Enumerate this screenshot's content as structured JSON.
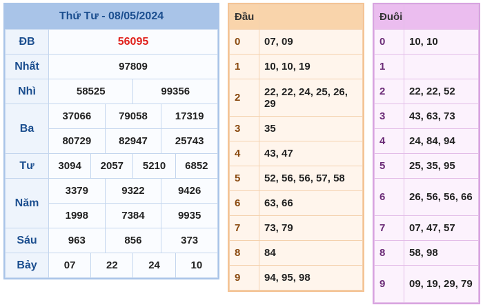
{
  "results": {
    "title": "Thứ Tư - 08/05/2024",
    "db": {
      "label": "ĐB",
      "value": "56095"
    },
    "nhat": {
      "label": "Nhất",
      "value": "97809"
    },
    "nhi": {
      "label": "Nhì",
      "values": [
        "58525",
        "99356"
      ]
    },
    "ba": {
      "label": "Ba",
      "values": [
        "37066",
        "79058",
        "17319",
        "80729",
        "82947",
        "25743"
      ]
    },
    "tu": {
      "label": "Tư",
      "values": [
        "3094",
        "2057",
        "5210",
        "6852"
      ]
    },
    "nam": {
      "label": "Năm",
      "values": [
        "3379",
        "9322",
        "9426",
        "1998",
        "7384",
        "9935"
      ]
    },
    "sau": {
      "label": "Sáu",
      "values": [
        "963",
        "856",
        "373"
      ]
    },
    "bay": {
      "label": "Bảy",
      "values": [
        "07",
        "22",
        "24",
        "10"
      ]
    }
  },
  "dau": {
    "header": "Đầu",
    "rows": [
      {
        "key": "0",
        "value": "07, 09"
      },
      {
        "key": "1",
        "value": "10, 10, 19"
      },
      {
        "key": "2",
        "value": "22, 22, 24, 25, 26, 29"
      },
      {
        "key": "3",
        "value": "35"
      },
      {
        "key": "4",
        "value": "43, 47"
      },
      {
        "key": "5",
        "value": "52, 56, 56, 57, 58"
      },
      {
        "key": "6",
        "value": "63, 66"
      },
      {
        "key": "7",
        "value": "73, 79"
      },
      {
        "key": "8",
        "value": "84"
      },
      {
        "key": "9",
        "value": "94, 95, 98"
      }
    ]
  },
  "duoi": {
    "header": "Đuôi",
    "rows": [
      {
        "key": "0",
        "value": "10, 10"
      },
      {
        "key": "1",
        "value": ""
      },
      {
        "key": "2",
        "value": "22, 22, 52"
      },
      {
        "key": "3",
        "value": "43, 63, 73"
      },
      {
        "key": "4",
        "value": "24, 84, 94"
      },
      {
        "key": "5",
        "value": "25, 35, 95"
      },
      {
        "key": "6",
        "value": "26, 56, 56, 66"
      },
      {
        "key": "7",
        "value": "07, 47, 57"
      },
      {
        "key": "8",
        "value": "58, 98"
      },
      {
        "key": "9",
        "value": "09, 19, 29, 79"
      }
    ]
  },
  "colors": {
    "results_header": "#a9c4e8",
    "label_text": "#1b4e8f",
    "special_prize": "#e0201b",
    "dau_header": "#f9d4ab",
    "dau_key": "#8a4a10",
    "duoi_header": "#ebbdef",
    "duoi_key": "#6a2a76"
  }
}
